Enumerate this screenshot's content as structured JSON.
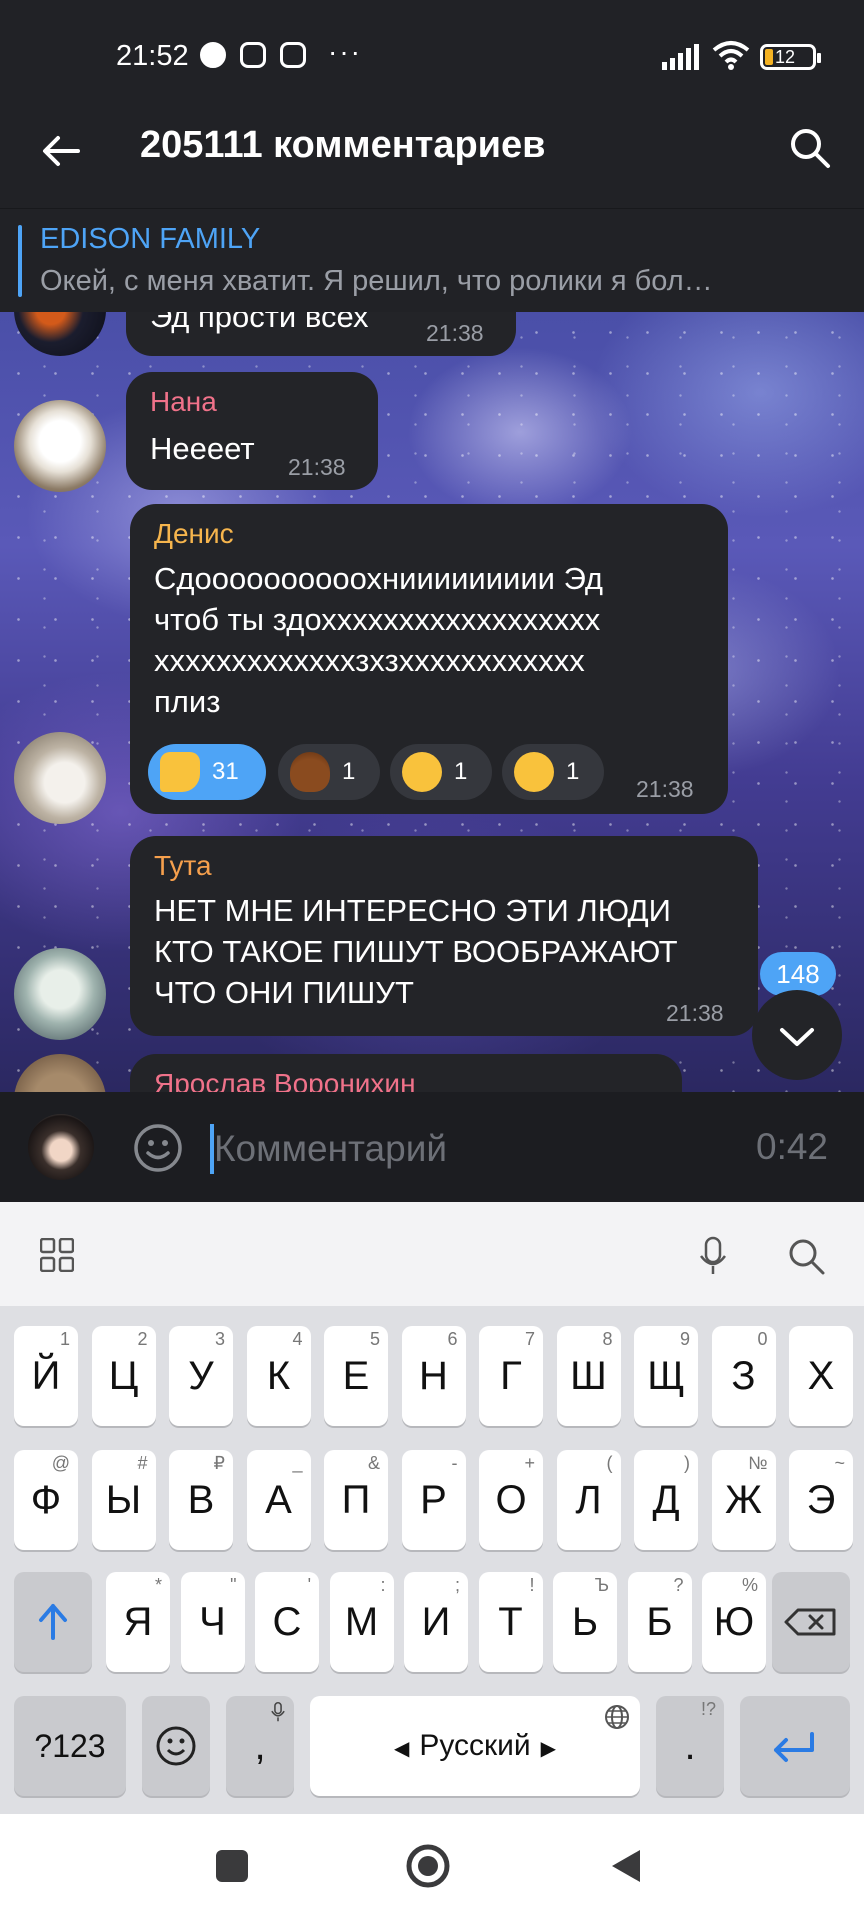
{
  "status": {
    "time": "21:52",
    "dots": "···",
    "battery_level": "12"
  },
  "header": {
    "title": "205111 комментариев"
  },
  "pinned": {
    "author": "EDISON FAMILY",
    "text": "Окей, с меня хватит. Я решил, что ролики я бол…"
  },
  "messages": [
    {
      "author": "",
      "text": "Эд прости всех",
      "time": "21:38"
    },
    {
      "author": "Нана",
      "text": "Нееeет",
      "time": "21:38"
    },
    {
      "author": "Денис",
      "text_lines": [
        "Сдоооооооооохниииииииии Эд",
        "чтоб ты здохххххххххххххххххх",
        "хххххххххххххзхзхххххххххххх",
        "плиз"
      ],
      "time": "21:38",
      "reactions": [
        {
          "emoji": "thumbs-down",
          "count": "31"
        },
        {
          "emoji": "poop",
          "count": "1"
        },
        {
          "emoji": "raised-eyebrow",
          "count": "1"
        },
        {
          "emoji": "neutral-face",
          "count": "1"
        }
      ]
    },
    {
      "author": "Тута",
      "text_lines": [
        "НЕТ МНЕ ИНТЕРЕСНО ЭТИ ЛЮДИ",
        "КТО ТАКОЕ ПИШУТ ВООБРАЖАЮТ",
        "ЧТО ОНИ ПИШУТ"
      ],
      "time": "21:38"
    },
    {
      "author": "Ярослав Воронихин"
    }
  ],
  "unread_count": "148",
  "input": {
    "placeholder": "Комментарий",
    "timer": "0:42"
  },
  "keyboard": {
    "row1": [
      {
        "k": "Й",
        "s": "1"
      },
      {
        "k": "Ц",
        "s": "2"
      },
      {
        "k": "У",
        "s": "3"
      },
      {
        "k": "К",
        "s": "4"
      },
      {
        "k": "Е",
        "s": "5"
      },
      {
        "k": "Н",
        "s": "6"
      },
      {
        "k": "Г",
        "s": "7"
      },
      {
        "k": "Ш",
        "s": "8"
      },
      {
        "k": "Щ",
        "s": "9"
      },
      {
        "k": "З",
        "s": "0"
      },
      {
        "k": "Х",
        "s": ""
      }
    ],
    "row2": [
      {
        "k": "Ф",
        "s": "@"
      },
      {
        "k": "Ы",
        "s": "#"
      },
      {
        "k": "В",
        "s": "₽"
      },
      {
        "k": "А",
        "s": "_"
      },
      {
        "k": "П",
        "s": "&"
      },
      {
        "k": "Р",
        "s": "-"
      },
      {
        "k": "О",
        "s": "+"
      },
      {
        "k": "Л",
        "s": "("
      },
      {
        "k": "Д",
        "s": ")"
      },
      {
        "k": "Ж",
        "s": "№"
      },
      {
        "k": "Э",
        "s": "~"
      }
    ],
    "row3": [
      {
        "k": "Я",
        "s": "*"
      },
      {
        "k": "Ч",
        "s": "\""
      },
      {
        "k": "С",
        "s": "'"
      },
      {
        "k": "М",
        "s": ":"
      },
      {
        "k": "И",
        "s": ";"
      },
      {
        "k": "Т",
        "s": "!"
      },
      {
        "k": "Ь",
        "s": "Ъ"
      },
      {
        "k": "Б",
        "s": "?"
      },
      {
        "k": "Ю",
        "s": "%"
      }
    ],
    "numbers_label": "?123",
    "comma": ",",
    "space_label": "Русский",
    "period": ".",
    "period_sup": "!?"
  }
}
